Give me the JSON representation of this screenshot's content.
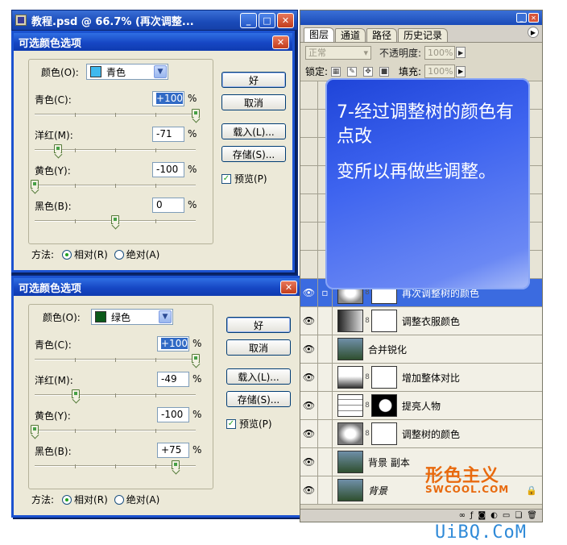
{
  "document": {
    "title": "教程.psd @ 66.7% (再次调整..."
  },
  "dialog1": {
    "title": "可选颜色选项",
    "colors_label": "颜色(O):",
    "color_value": "青色",
    "swatch_color": "#3fb9ee",
    "rows": [
      {
        "label": "青色(C):",
        "value": "+100",
        "percent": 100
      },
      {
        "label": "洋红(M):",
        "value": "-71",
        "percent": -71
      },
      {
        "label": "黄色(Y):",
        "value": "-100",
        "percent": -100
      },
      {
        "label": "黑色(B):",
        "value": "0",
        "percent": 0
      }
    ],
    "buttons": {
      "ok": "好",
      "cancel": "取消",
      "load": "载入(L)...",
      "save": "存储(S)..."
    },
    "preview_label": "预览(P)",
    "method_label": "方法:",
    "relative_label": "相对(R)",
    "absolute_label": "绝对(A)",
    "method_selected": "relative"
  },
  "dialog2": {
    "title": "可选颜色选项",
    "colors_label": "颜色(O):",
    "color_value": "绿色",
    "swatch_color": "#0b5a1a",
    "rows": [
      {
        "label": "青色(C):",
        "value": "+100",
        "percent": 100
      },
      {
        "label": "洋红(M):",
        "value": "-49",
        "percent": -49
      },
      {
        "label": "黄色(Y):",
        "value": "-100",
        "percent": -100
      },
      {
        "label": "黑色(B):",
        "value": "+75",
        "percent": 75
      }
    ],
    "buttons": {
      "ok": "好",
      "cancel": "取消",
      "load": "载入(L)...",
      "save": "存储(S)..."
    },
    "preview_label": "预览(P)",
    "method_label": "方法:",
    "relative_label": "相对(R)",
    "absolute_label": "绝对(A)",
    "method_selected": "relative"
  },
  "panel": {
    "tabs": [
      "图层",
      "通道",
      "路径",
      "历史记录"
    ],
    "blend_mode": "正常",
    "opacity_label": "不透明度:",
    "opacity_value": "100%",
    "lock_label": "锁定:",
    "fill_label": "填充:",
    "fill_value": "100%",
    "layers": [
      {
        "name": "再次调整树的颜色",
        "active": true
      },
      {
        "name": "调整衣服颜色",
        "active": false
      },
      {
        "name": "合并锐化",
        "active": false
      },
      {
        "name": "增加整体对比",
        "active": false
      },
      {
        "name": "提亮人物",
        "active": false
      },
      {
        "name": "调整树的颜色",
        "active": false
      },
      {
        "name": "背景 副本",
        "active": false
      },
      {
        "name": "背景",
        "active": false
      }
    ]
  },
  "note": {
    "line1": "7-经过调整树的颜色有点改",
    "line2": "变所以再做些调整。"
  },
  "watermark": {
    "brand_cn": "形色主义",
    "brand_en": "SWCOOL.COM",
    "site": "UiBQ.CoM"
  }
}
